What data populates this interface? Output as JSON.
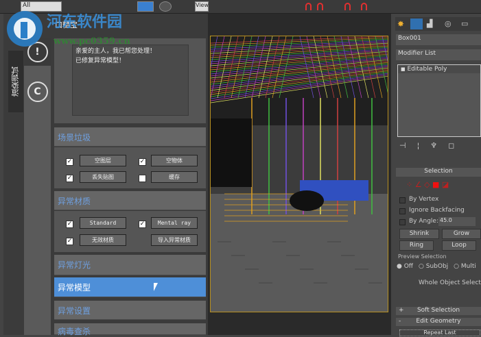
{
  "watermark": {
    "name": "河东软件园",
    "url": "www.pc0359.cn"
  },
  "toolbar": {
    "filter": "All",
    "view": "View"
  },
  "plugin": {
    "title": "口糙宝",
    "side_tab": "渲染调试",
    "messages": [
      "亲爱的主人，我已帮您处理！",
      "已修复异常模型！"
    ],
    "sections": [
      {
        "label": "场景垃圾",
        "items": [
          {
            "label": "空图层",
            "checked": true
          },
          {
            "label": "空物体",
            "checked": true
          },
          {
            "label": "丢失贴图",
            "checked": true
          },
          {
            "label": "缓存",
            "checked": false
          }
        ]
      },
      {
        "label": "异常材质",
        "items": [
          {
            "label": "Standard",
            "checked": true
          },
          {
            "label": "Mental ray",
            "checked": true
          },
          {
            "label": "无效材质",
            "checked": true
          },
          {
            "label": "导入异常材质",
            "checked": null
          }
        ]
      },
      {
        "label": "异常灯光"
      },
      {
        "label": "异常模型",
        "active": true
      },
      {
        "label": "异常设置"
      },
      {
        "label": "病毒查杀"
      }
    ]
  },
  "right_panel": {
    "object_name": "Box001",
    "modifier_list": "Modifier List",
    "stack_item": "Editable Poly",
    "selection_title": "Selection",
    "by_vertex": "By Vertex",
    "ignore_backfacing": "Ignore Backfacing",
    "by_angle": "By Angle:",
    "angle_value": "45.0",
    "shrink": "Shrink",
    "grow": "Grow",
    "ring": "Ring",
    "loop": "Loop",
    "preview_selection": "Preview Selection",
    "preview_opts": [
      "Off",
      "SubObj",
      "Multi"
    ],
    "status": "Whole Object Selected",
    "soft_selection": "Soft Selection",
    "edit_geometry": "Edit Geometry",
    "repeat_last": "Repeat Last"
  }
}
